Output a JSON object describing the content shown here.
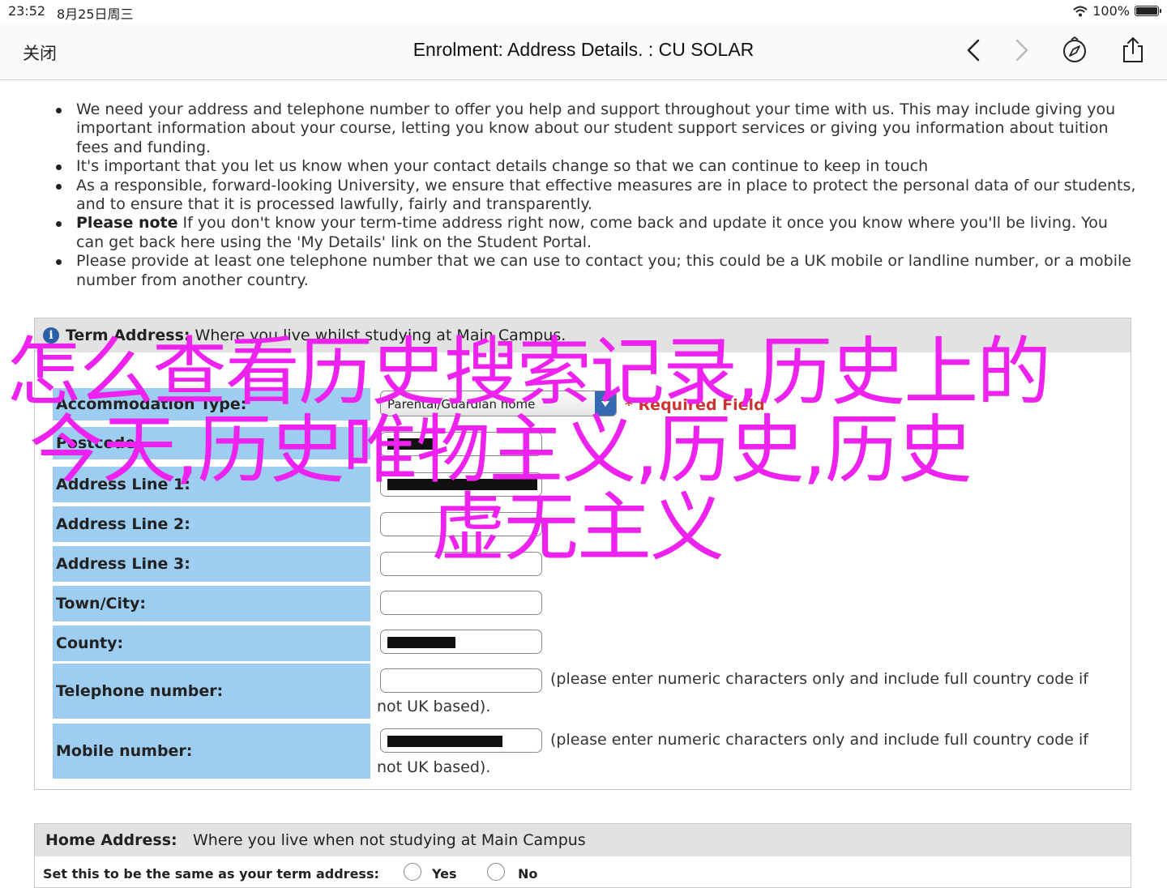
{
  "status_bar": {
    "time": "23:52",
    "date": "8月25日周三",
    "battery": "100%"
  },
  "nav": {
    "close_label": "关闭",
    "title": "Enrolment: Address Details. : CU SOLAR"
  },
  "bullets": [
    {
      "bold": "",
      "text": "We need your address and telephone number to offer you help and support throughout your time with us. This may include giving you important information about your course, letting you know about our student support services or giving you information about tuition fees and funding."
    },
    {
      "bold": "",
      "text": "It's important that you let us know when your contact details change so that we can continue to keep in touch"
    },
    {
      "bold": "",
      "text": "As a responsible, forward-looking University, we ensure that effective measures are in place to protect the personal data of our students, and to ensure that it is processed lawfully, fairly and transparently."
    },
    {
      "bold": "Please note",
      "text": " If you don't know your term-time address right now, come back and update it once you know where you'll be living. You can get back here using the 'My Details' link on the Student Portal."
    },
    {
      "bold": "",
      "text": "Please provide at least one telephone number that we can use to contact you; this could be a UK mobile or landline number, or a mobile number from another country."
    }
  ],
  "term_address": {
    "heading": "Term Address:",
    "description": "Where you live whilst studying at Main Campus.",
    "accommodation_label": "Accommodation Type:",
    "accommodation_value": "Parental/Guardian home",
    "required_note": "* Required Field",
    "postcode_label": "Postcode:",
    "address1_label": "Address Line 1:",
    "address2_label": "Address Line 2:",
    "address3_label": "Address Line 3:",
    "town_label": "Town/City:",
    "county_label": "County:",
    "telephone_label": "Telephone number:",
    "mobile_label": "Mobile number:",
    "phone_hint_1": "(please enter numeric characters only and include full country code if",
    "phone_hint_2": "not UK based)."
  },
  "home_address": {
    "heading": "Home Address:",
    "description": "Where you live when not studying at Main Campus",
    "same_as_label": "Set this to be the same as your term address:",
    "yes_label": "Yes",
    "no_label": "No"
  },
  "overlay": {
    "line1": "怎么查看历史搜索记录,历史上的",
    "line2": "今天,历史唯物主义,历史,历史",
    "line3": "虚无主义"
  },
  "colors": {
    "label_bg": "#9dcdf0",
    "overlay_text": "#ee22ee",
    "required": "#cc3333"
  },
  "icons": [
    "wifi-icon",
    "battery-icon",
    "back-icon",
    "forward-icon",
    "compass-icon",
    "share-icon",
    "info-icon"
  ]
}
